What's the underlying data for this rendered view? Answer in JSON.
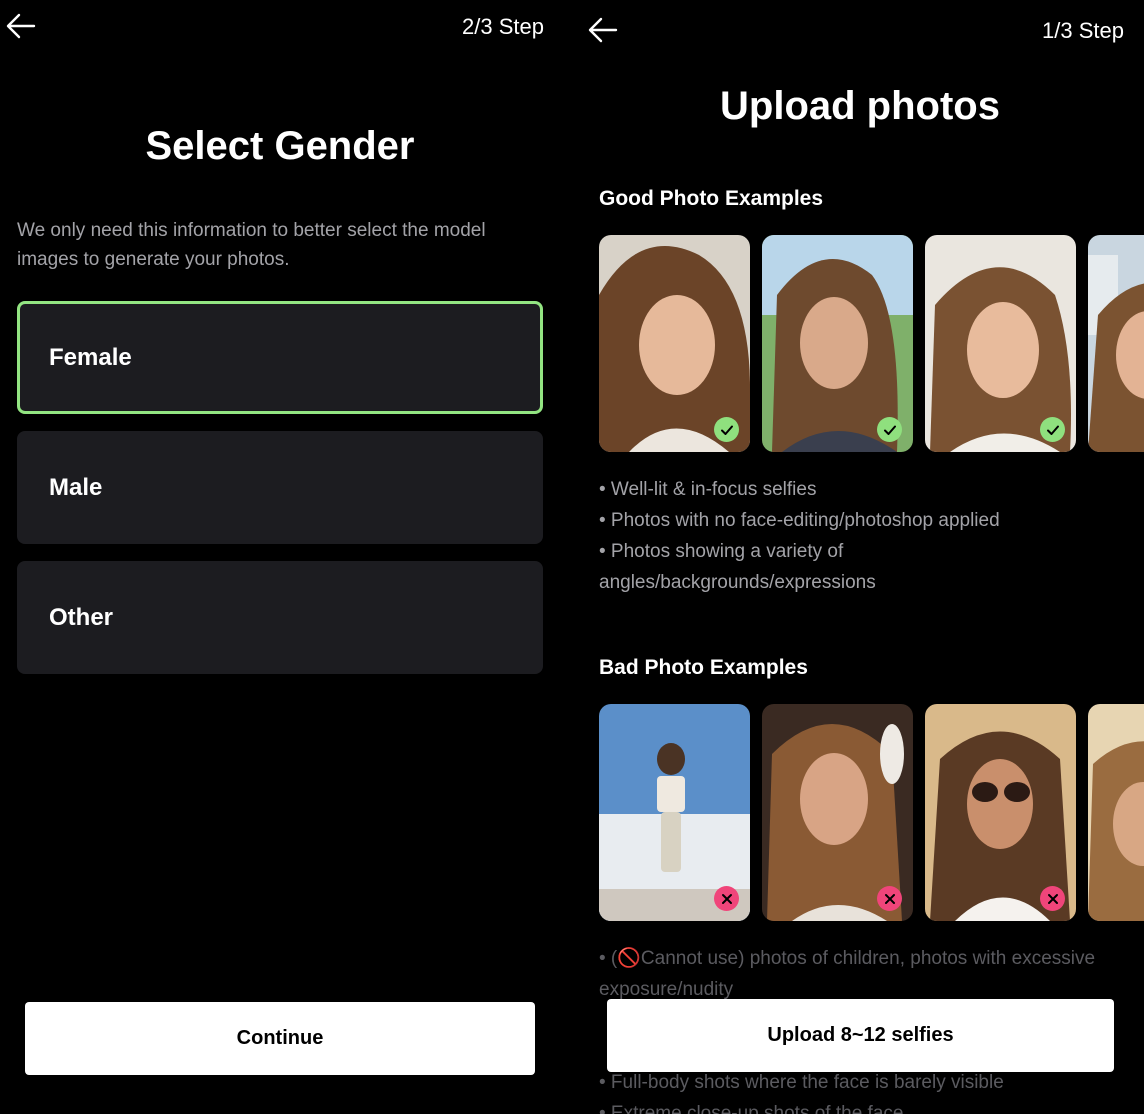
{
  "gender_screen": {
    "step": "2/3 Step",
    "title": "Select Gender",
    "description": "We only need this information to better select the model images to generate your photos.",
    "options": [
      {
        "label": "Female",
        "selected": true
      },
      {
        "label": "Male",
        "selected": false
      },
      {
        "label": "Other",
        "selected": false
      }
    ],
    "continue_label": "Continue"
  },
  "upload_screen": {
    "step": "1/3 Step",
    "title": "Upload photos",
    "good_heading": "Good Photo Examples",
    "good_tips": [
      "• Well-lit & in-focus selfies",
      "• Photos with no face-editing/photoshop applied",
      "• Photos showing a variety of angles/backgrounds/expressions"
    ],
    "bad_heading": "Bad Photo Examples",
    "bad_tips": [
      "• (🚫Cannot use) photos of children, photos with excessive exposure/nudity",
      "• Full-body shots where the face is barely visible",
      "• Extreme close-up shots of the face"
    ],
    "upload_label": "Upload 8~12 selfies"
  },
  "icons": {
    "back": "arrow-left-icon",
    "good_badge": "check-circle-icon",
    "bad_badge": "x-circle-icon"
  },
  "colors": {
    "accent_green": "#93e582",
    "bad_pink": "#f0457a",
    "card_bg": "#1c1c20",
    "muted_text": "#a3a3a8"
  }
}
